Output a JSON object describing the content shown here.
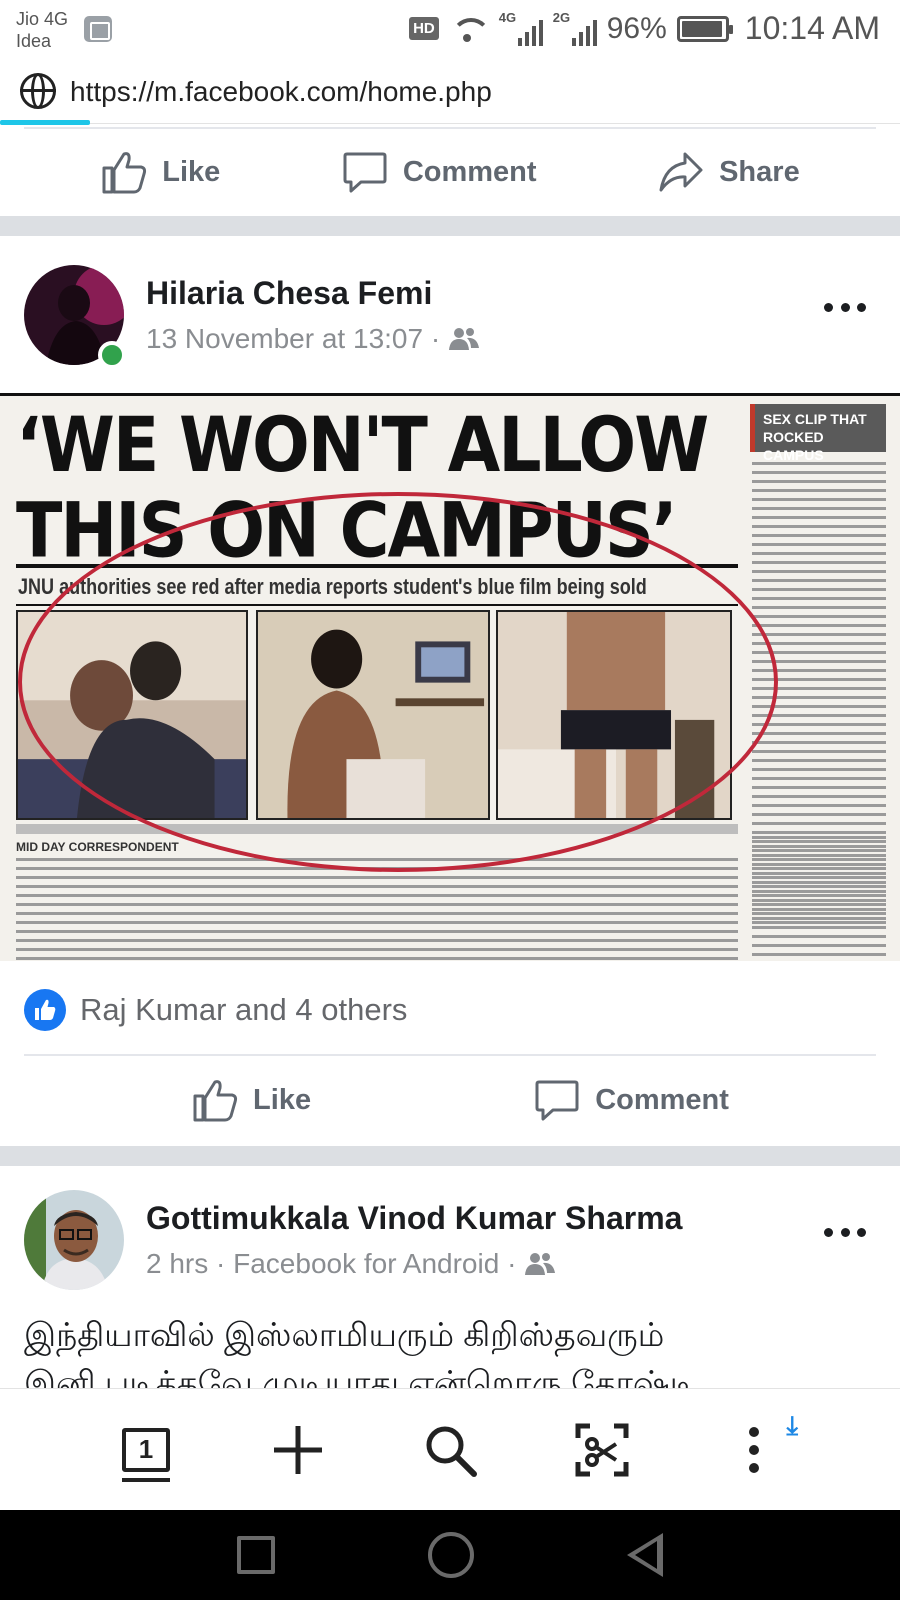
{
  "status_bar": {
    "carrier_line1": "Jio 4G",
    "carrier_line2": "Idea",
    "hd": "HD",
    "sim1_network": "4G",
    "sim2_network": "2G",
    "battery": "96%",
    "battery_level": 0.96,
    "time": "10:14 AM"
  },
  "browser": {
    "url": "https://m.facebook.com/home.php",
    "load_progress": 0.1
  },
  "top_actions": {
    "like": "Like",
    "comment": "Comment",
    "share": "Share"
  },
  "post1": {
    "author": "Hilaria Chesa Femi",
    "timestamp": "13 November at 13:07 ·",
    "audience_icon": "friends-icon",
    "image": {
      "headline_line1": "‘WE WON'T ALLOW",
      "headline_line2": "THIS ON CAMPUS’",
      "deck": "JNU authorities see red after media reports student's blue film being sold",
      "sidebar_label": "SEX CLIP THAT ROCKED CAMPUS",
      "byline": "MID DAY CORRESPONDENT",
      "annotation_color": "#c0283a"
    },
    "reactions_text": "Raj Kumar and 4 others",
    "actions": {
      "like": "Like",
      "comment": "Comment"
    }
  },
  "post2": {
    "author": "Gottimukkala Vinod Kumar Sharma",
    "timestamp": "2 hrs · Facebook for Android ·",
    "audience_icon": "friends-icon",
    "text_line1": "இந்தியாவில் இஸ்லாமியரும் கிறிஸ்தவரும்",
    "text_line2": "இனி படிக்கவே முடியாது என்றொரு கோஷ்டி"
  },
  "toolbar": {
    "tab_count": "1",
    "icons": [
      "tabs-icon",
      "new-tab-icon",
      "search-icon",
      "screenshot-icon",
      "menu-icon"
    ]
  },
  "colors": {
    "facebook_blue": "#1877f2",
    "online_green": "#31a24c",
    "progress_cyan": "#1ec6e8",
    "download_blue": "#1e88e5"
  }
}
